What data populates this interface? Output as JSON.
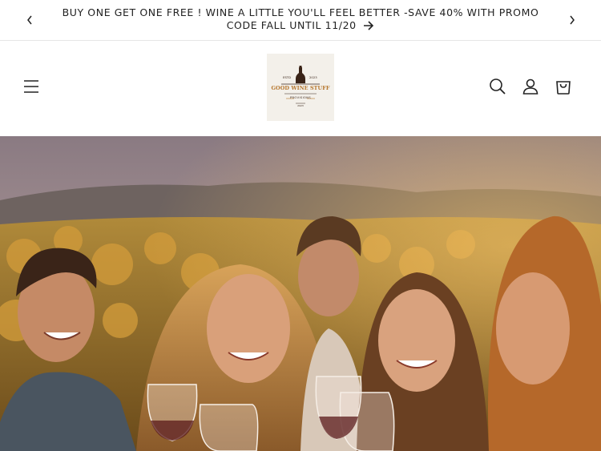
{
  "announcement": {
    "text": "BUY ONE GET ONE FREE ! WINE A LITTLE YOU'LL FEEL BETTER -SAVE 40% WITH PROMO CODE FALL UNTIL 11/20",
    "prev_icon": "chevron-left-icon",
    "next_icon": "chevron-right-icon",
    "link_icon": "arrow-right-icon"
  },
  "header": {
    "menu_icon": "hamburger-menu-icon",
    "logo": {
      "brand": "GOOD WINE STUFF",
      "est_left": "ESTD",
      "est_right": "2023",
      "tagline": "PROVISIONS",
      "bottom": "2023"
    },
    "icons": [
      "search-icon",
      "account-icon",
      "cart-icon"
    ]
  },
  "hero": {
    "alt_subject": "friends toasting wine in a vineyard"
  }
}
